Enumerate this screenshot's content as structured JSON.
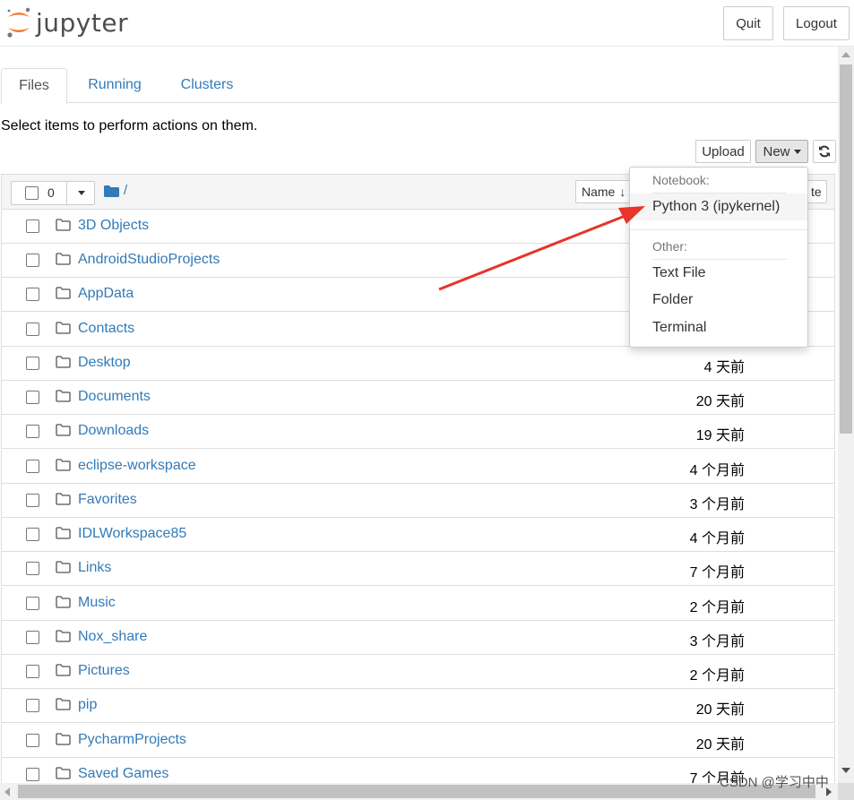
{
  "header": {
    "logo_text": "jupyter",
    "quit_label": "Quit",
    "logout_label": "Logout"
  },
  "tabs": [
    {
      "label": "Files",
      "active": true
    },
    {
      "label": "Running",
      "active": false
    },
    {
      "label": "Clusters",
      "active": false
    }
  ],
  "instruction": "Select items to perform actions on them.",
  "toolbar": {
    "upload_label": "Upload",
    "new_label": "New",
    "refresh_icon": "refresh-icon"
  },
  "list_header": {
    "selected_count": "0",
    "breadcrumb": "/",
    "name_sort_label": "Name",
    "modified_sort_label_partial": "te"
  },
  "files": [
    {
      "name": "3D Objects",
      "modified": ""
    },
    {
      "name": "AndroidStudioProjects",
      "modified": ""
    },
    {
      "name": "AppData",
      "modified": ""
    },
    {
      "name": "Contacts",
      "modified": ""
    },
    {
      "name": "Desktop",
      "modified": "4 天前"
    },
    {
      "name": "Documents",
      "modified": "20 天前"
    },
    {
      "name": "Downloads",
      "modified": "19 天前"
    },
    {
      "name": "eclipse-workspace",
      "modified": "4 个月前"
    },
    {
      "name": "Favorites",
      "modified": "3 个月前"
    },
    {
      "name": "IDLWorkspace85",
      "modified": "4 个月前"
    },
    {
      "name": "Links",
      "modified": "7 个月前"
    },
    {
      "name": "Music",
      "modified": "2 个月前"
    },
    {
      "name": "Nox_share",
      "modified": "3 个月前"
    },
    {
      "name": "Pictures",
      "modified": "2 个月前"
    },
    {
      "name": "pip",
      "modified": "20 天前"
    },
    {
      "name": "PycharmProjects",
      "modified": "20 天前"
    },
    {
      "name": "Saved Games",
      "modified": "7 个月前"
    }
  ],
  "new_menu": {
    "notebook_header": "Notebook:",
    "python_kernel": "Python 3 (ipykernel)",
    "other_header": "Other:",
    "text_file": "Text File",
    "folder": "Folder",
    "terminal": "Terminal"
  },
  "colors": {
    "link": "#337ab7",
    "logo_orange": "#f37726",
    "annotation_arrow": "#e8342a"
  },
  "watermark": "CSDN @学习中中"
}
